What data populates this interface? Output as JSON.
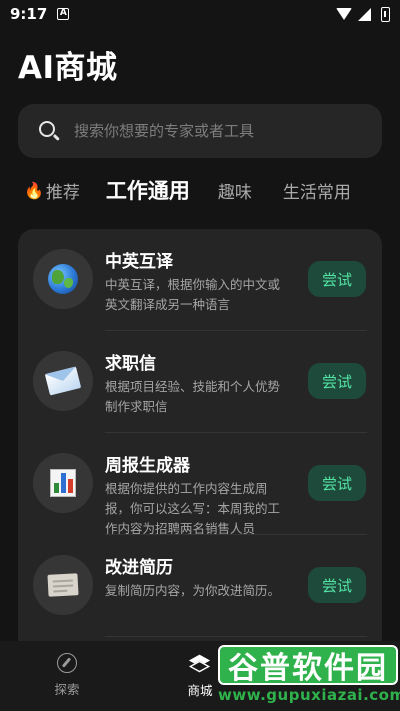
{
  "status_bar": {
    "time": "9:17",
    "notification": "A"
  },
  "app": {
    "title": "AI商城"
  },
  "search": {
    "placeholder": "搜索你想要的专家或者工具"
  },
  "tabs": [
    {
      "label": "推荐",
      "icon": "fire-icon",
      "active": false
    },
    {
      "label": "工作通用",
      "active": true
    },
    {
      "label": "趣味",
      "active": false
    },
    {
      "label": "生活常用",
      "active": false
    }
  ],
  "tools": [
    {
      "title": "中英互译",
      "description": "中英互译，根据你输入的中文或英文翻译成另一种语言",
      "button": "尝试",
      "icon": "globe-icon"
    },
    {
      "title": "求职信",
      "description": "根据项目经验、技能和个人优势制作求职信",
      "button": "尝试",
      "icon": "envelope-icon"
    },
    {
      "title": "周报生成器",
      "description": "根据你提供的工作内容生成周报，你可以这么写：本周我的工作内容为招聘两名销售人员",
      "button": "尝试",
      "icon": "bar-chart-icon"
    },
    {
      "title": "改进简历",
      "description": "复制简历内容，为你改进简历。",
      "button": "尝试",
      "icon": "document-icon"
    }
  ],
  "bottom_nav": [
    {
      "label": "探索",
      "icon": "compass-icon",
      "active": false
    },
    {
      "label": "商城",
      "icon": "layers-icon",
      "active": true
    }
  ],
  "watermark": {
    "title": "谷普软件园",
    "url": "www.gupuxiazai.com"
  },
  "colors": {
    "background": "#141414",
    "card": "#252525",
    "accent": "#53e3a3",
    "button_bg": "#1e4a3c"
  }
}
